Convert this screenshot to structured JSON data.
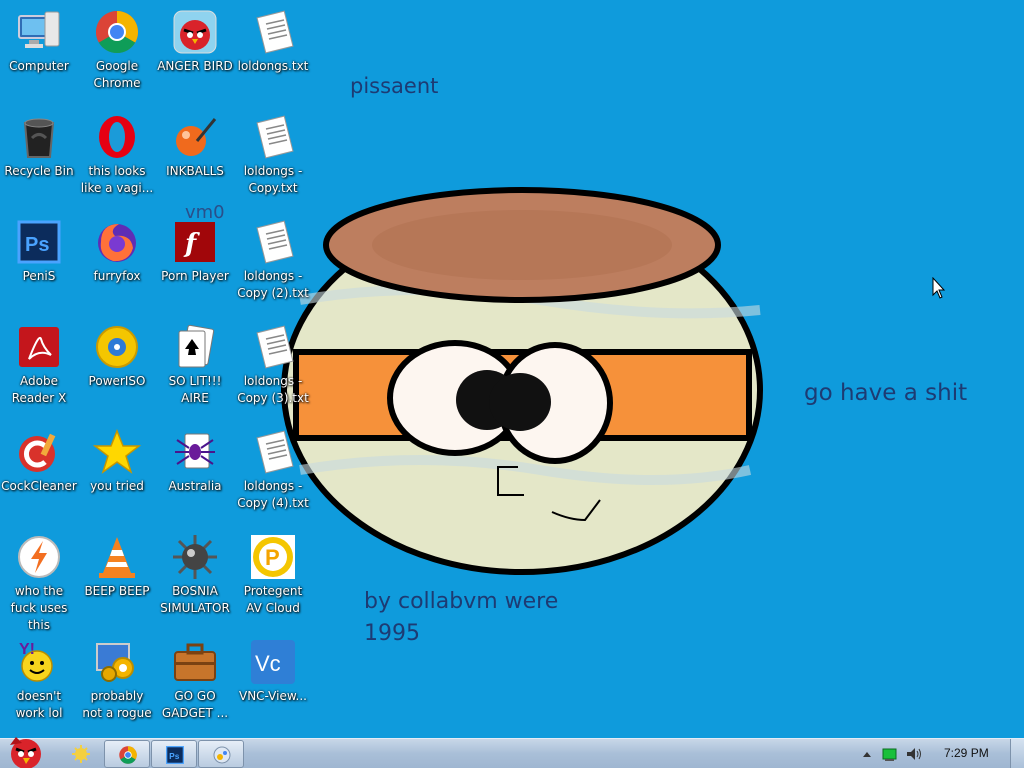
{
  "wallpaper": {
    "texts": [
      "pissaent",
      "vm0",
      "go have a shit",
      "by collabvm were 1995"
    ]
  },
  "icons": [
    {
      "label": "Computer",
      "icon": "computer-icon"
    },
    {
      "label": "Google Chrome",
      "icon": "chrome-icon"
    },
    {
      "label": "ANGER BIRD",
      "icon": "angry-bird-icon"
    },
    {
      "label": "loldongs.txt",
      "icon": "text-file-icon"
    },
    {
      "label": "Recycle Bin",
      "icon": "recycle-bin-icon"
    },
    {
      "label": "this looks like a vagi...",
      "icon": "opera-icon"
    },
    {
      "label": "INKBALLS",
      "icon": "inkball-icon"
    },
    {
      "label": "loldongs - Copy.txt",
      "icon": "text-file-icon"
    },
    {
      "label": "PeniS",
      "icon": "photoshop-icon"
    },
    {
      "label": "furryfox",
      "icon": "firefox-icon"
    },
    {
      "label": "Porn Player",
      "icon": "flash-icon"
    },
    {
      "label": "loldongs - Copy (2).txt",
      "icon": "text-file-icon"
    },
    {
      "label": "Adobe Reader X",
      "icon": "adobe-reader-icon"
    },
    {
      "label": "PowerISO",
      "icon": "poweriso-icon"
    },
    {
      "label": "SO LIT!!! AIRE",
      "icon": "solitaire-icon"
    },
    {
      "label": "loldongs - Copy (3).txt",
      "icon": "text-file-icon"
    },
    {
      "label": "CockCleaner",
      "icon": "ccleaner-icon"
    },
    {
      "label": "you tried",
      "icon": "star-icon"
    },
    {
      "label": "Australia",
      "icon": "spider-solitaire-icon"
    },
    {
      "label": "loldongs - Copy (4).txt",
      "icon": "text-file-icon"
    },
    {
      "label": "who the fuck uses this",
      "icon": "avast-icon"
    },
    {
      "label": "BEEP BEEP",
      "icon": "vlc-icon"
    },
    {
      "label": "BOSNIA SIMULATOR",
      "icon": "minesweeper-icon"
    },
    {
      "label": "Protegent AV Cloud",
      "icon": "protegent-icon"
    },
    {
      "label": "doesn't work lol",
      "icon": "yahoo-messenger-icon"
    },
    {
      "label": "probably not a rogue",
      "icon": "system-tool-icon"
    },
    {
      "label": "GO GO GADGET ...",
      "icon": "briefcase-icon"
    },
    {
      "label": "VNC-View...",
      "icon": "vnc-icon"
    }
  ],
  "taskbar": {
    "start": "start-orb-angry-bird-icon",
    "pinned": [
      "explorer-icon",
      "chrome-icon",
      "photoshop-icon",
      "media-icon"
    ],
    "clock": "7:29 PM"
  },
  "colors": {
    "desktop": "#0f9bdc",
    "taskbar": "#a9bfd8"
  }
}
